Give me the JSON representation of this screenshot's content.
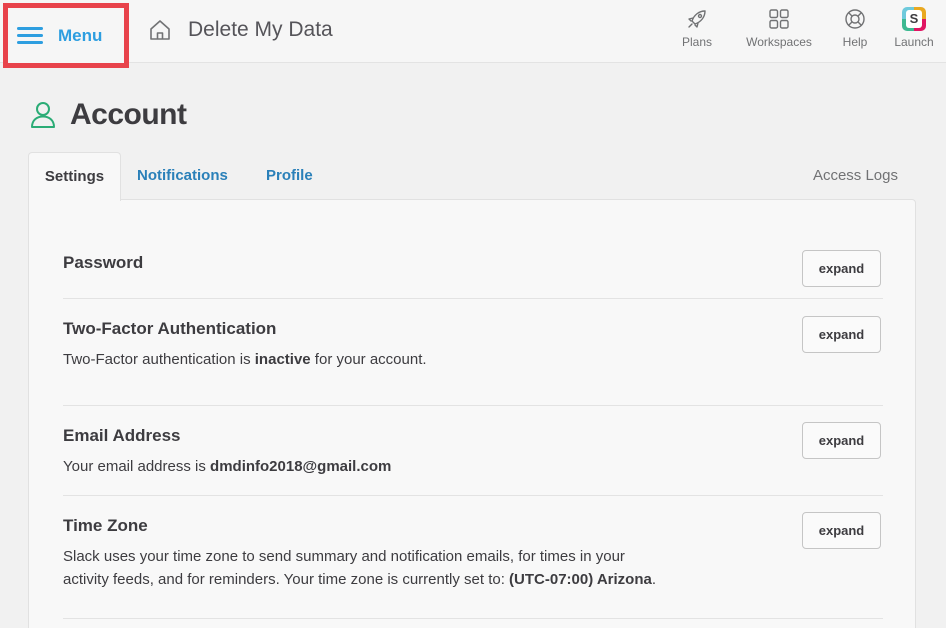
{
  "topbar": {
    "menu_label": "Menu",
    "site_title": "Delete My Data",
    "nav": {
      "plans": "Plans",
      "workspaces": "Workspaces",
      "help": "Help",
      "launch": "Launch"
    },
    "launch_logo_letter": "S"
  },
  "page": {
    "title": "Account"
  },
  "tabs": {
    "settings": "Settings",
    "notifications": "Notifications",
    "profile": "Profile",
    "access_logs": "Access Logs"
  },
  "sections": {
    "expand_label": "expand",
    "password": {
      "title": "Password"
    },
    "two_factor": {
      "title": "Two-Factor Authentication",
      "desc_prefix": "Two-Factor authentication is ",
      "desc_status": "inactive",
      "desc_suffix": " for your account."
    },
    "email": {
      "title": "Email Address",
      "desc_prefix": "Your email address is ",
      "desc_value": "dmdinfo2018@gmail.com"
    },
    "timezone": {
      "title": "Time Zone",
      "desc_line1": "Slack uses your time zone to send summary and notification emails, for times in your",
      "desc_line2_prefix": "activity feeds, and for reminders. Your time zone is currently set to: ",
      "desc_value": "(UTC-07:00) Arizona",
      "desc_suffix": "."
    }
  },
  "colors": {
    "accent": "#2d9ee0",
    "link": "#2a80b9",
    "highlight_border": "#e8434b",
    "user_icon": "#2bac76"
  },
  "icons": {
    "menu": "hamburger-icon",
    "home": "home-icon",
    "plans": "rocket-icon",
    "workspaces": "grid-icon",
    "help": "lifebuoy-icon",
    "launch": "slack-logo-icon",
    "account": "user-icon"
  }
}
